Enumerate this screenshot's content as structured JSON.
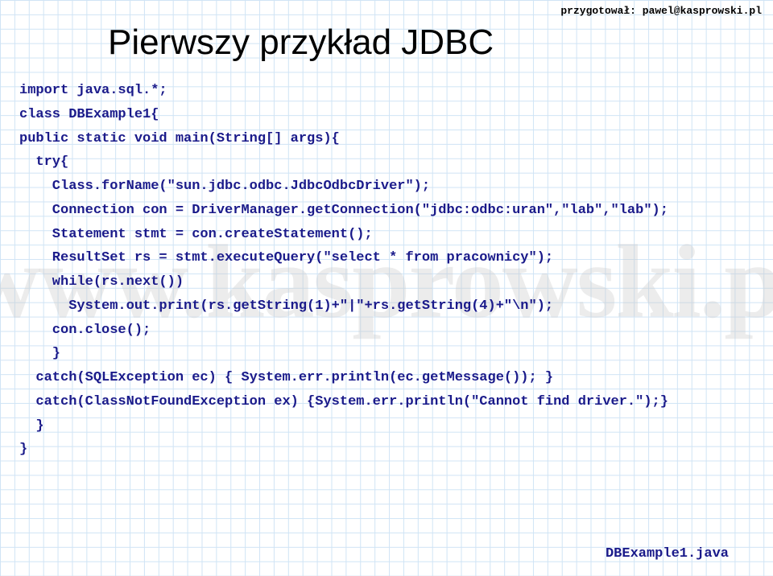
{
  "header": {
    "credit": "przygotował: pawel@kasprowski.pl"
  },
  "watermark": "www.kasprowski.pl",
  "title": "Pierwszy przykład JDBC",
  "code": {
    "l1": "import java.sql.*;",
    "l2": "class DBExample1{",
    "l3": "public static void main(String[] args){",
    "l4": "  try{",
    "l5": "    Class.forName(\"sun.jdbc.odbc.JdbcOdbcDriver\");",
    "l6": "    Connection con = DriverManager.getConnection(\"jdbc:odbc:uran\",\"lab\",\"lab\");",
    "l7": "    Statement stmt = con.createStatement();",
    "l8": "    ResultSet rs = stmt.executeQuery(\"select * from pracownicy\");",
    "l9": "    while(rs.next())",
    "l10": "      System.out.print(rs.getString(1)+\"|\"+rs.getString(4)+\"\\n\");",
    "l11": "    con.close();",
    "l12": "    }",
    "l13": "  catch(SQLException ec) { System.err.println(ec.getMessage()); }",
    "l14": "  catch(ClassNotFoundException ex) {System.err.println(\"Cannot find driver.\");}",
    "l15": "  }",
    "l16": "}"
  },
  "footer": {
    "filename": "DBExample1.java"
  }
}
